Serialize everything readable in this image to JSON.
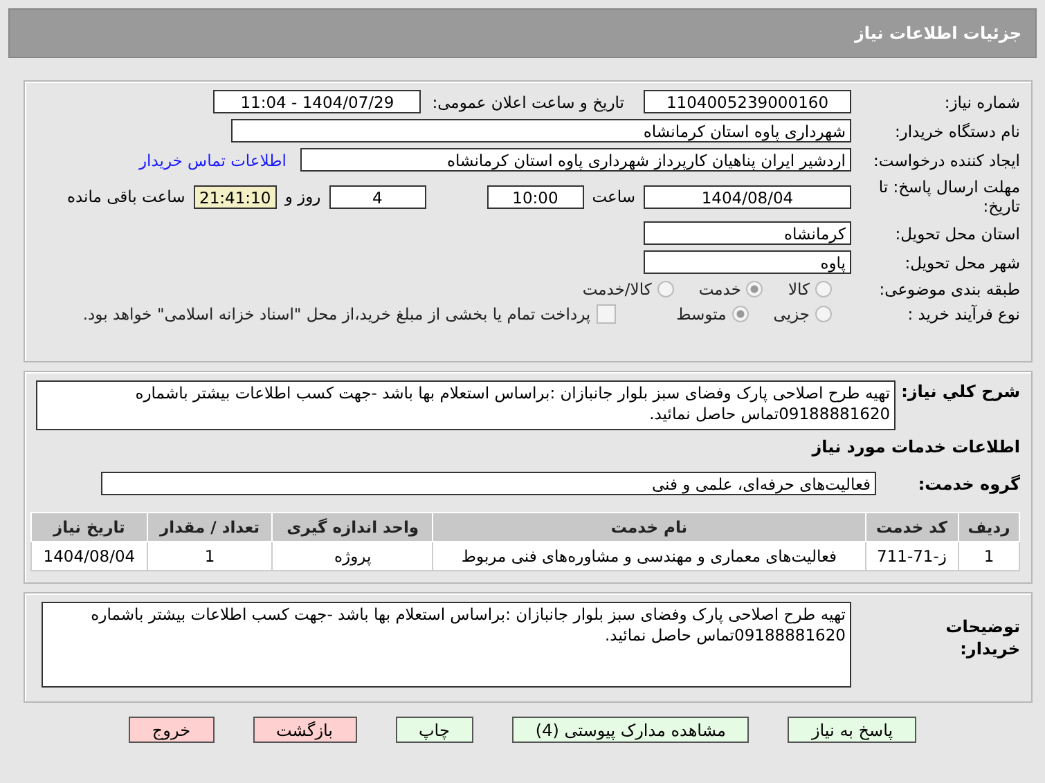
{
  "page_title": "جزئیات اطلاعات نیاز",
  "need": {
    "number_label": "شماره نیاز:",
    "number": "1104005239000160",
    "announce_label": "تاریخ و ساعت اعلان عمومی:",
    "announce": "1404/07/29 - 11:04",
    "buyer_label": "نام دستگاه خریدار:",
    "buyer": "شهرداری پاوه استان کرمانشاه",
    "creator_label": "ایجاد کننده درخواست:",
    "creator": "اردشیر ایران پناهیان کارپرداز شهرداری پاوه استان کرمانشاه",
    "contact_link": "اطلاعات تماس خریدار",
    "deadline_label": "مهلت ارسال پاسخ: تا تاریخ:",
    "deadline_date": "1404/08/04",
    "time_label": "ساعت",
    "deadline_time": "10:00",
    "days": "4",
    "days_label": "روز و",
    "remaining": "21:41:10",
    "remaining_label": "ساعت باقی مانده",
    "province_label": "استان محل تحویل:",
    "province": "کرمانشاه",
    "city_label": "شهر محل تحویل:",
    "city": "پاوه",
    "category_label": "طبقه بندی موضوعی:",
    "category_options": [
      {
        "label": "کالا",
        "selected": false
      },
      {
        "label": "خدمت",
        "selected": true
      },
      {
        "label": "کالا/خدمت",
        "selected": false
      }
    ],
    "process_label": "نوع فرآیند خرید :",
    "process_options": [
      {
        "label": "جزیی",
        "selected": false
      },
      {
        "label": "متوسط",
        "selected": true
      }
    ],
    "payment": {
      "checked": false,
      "text": "پرداخت تمام یا بخشی از مبلغ خرید،از محل \"اسناد خزانه اسلامی\" خواهد بود."
    }
  },
  "services": {
    "summary_label": "شرح کلي نياز:",
    "summary": "تهیه طرح اصلاحی پارک وفضای سبز بلوار جانبازان :براساس استعلام بها باشد -جهت کسب اطلاعات بیشتر باشماره 09188881620تماس حاصل نمائید.",
    "heading": "اطلاعات خدمات مورد نیاز",
    "group_label": "گروه خدمت:",
    "group": "فعالیت‌های حرفه‌ای، علمی و فنی",
    "table": {
      "columns": [
        "ردیف",
        "کد خدمت",
        "نام خدمت",
        "واحد اندازه گیری",
        "تعداد / مقدار",
        "تاریخ نیاز"
      ],
      "rows": [
        [
          "1",
          "ز-71-711",
          "فعالیت‌های معماری و مهندسی و مشاوره‌های فنی مربوط",
          "پروژه",
          "1",
          "1404/08/04"
        ]
      ]
    }
  },
  "notes": {
    "label": "توضیحات خریدار:",
    "text": "تهیه طرح اصلاحی پارک وفضای سبز بلوار جانبازان :براساس استعلام بها باشد -جهت کسب اطلاعات بیشتر باشماره 09188881620تماس حاصل نمائید."
  },
  "buttons": [
    {
      "label": "پاسخ به نیاز",
      "kind": "normal"
    },
    {
      "label": "مشاهده مدارک پیوستی (4)",
      "kind": "normal"
    },
    {
      "label": "چاپ",
      "kind": "normal"
    },
    {
      "label": "بازگشت",
      "kind": "danger"
    },
    {
      "label": "خروج",
      "kind": "danger"
    }
  ]
}
